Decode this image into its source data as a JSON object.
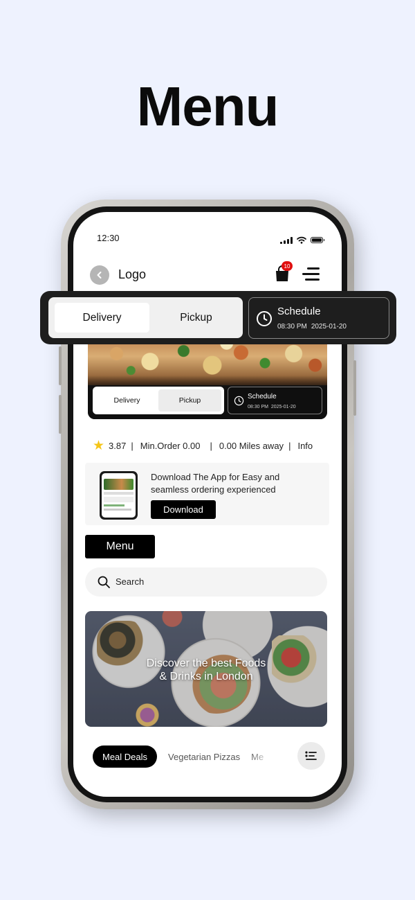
{
  "page": {
    "title": "Menu"
  },
  "status_bar": {
    "time": "12:30"
  },
  "header": {
    "logo_text": "Logo",
    "cart_count": "10"
  },
  "order_mode": {
    "options": [
      "Delivery",
      "Pickup"
    ],
    "selected": "Delivery",
    "schedule_label": "Schedule",
    "schedule_time": "08:30 PM",
    "schedule_date": "2025-01-20"
  },
  "store_info": {
    "rating": "3.87",
    "min_order": "Min.Order 0.00",
    "distance": "0.00 Miles away",
    "info_link": "Info"
  },
  "download_card": {
    "text": "Download The App for Easy and seamless ordering experienced",
    "button": "Download"
  },
  "menu_button": "Menu",
  "search": {
    "placeholder": "Search"
  },
  "banner": {
    "caption_line1": "Discover the best Foods",
    "caption_line2": "& Drinks in London"
  },
  "categories": {
    "items": [
      "Meal Deals",
      "Vegetarian Pizzas",
      "Me"
    ],
    "active": "Meal Deals"
  },
  "colors": {
    "background": "#eef2fe",
    "accent": "#000000",
    "badge": "#e01010",
    "star": "#f5c518"
  },
  "icons": [
    "chevron-left-icon",
    "shopping-bag-icon",
    "hamburger-menu-icon",
    "clock-icon",
    "star-icon",
    "search-icon",
    "filter-list-icon",
    "signal-icon",
    "wifi-icon",
    "battery-icon"
  ]
}
